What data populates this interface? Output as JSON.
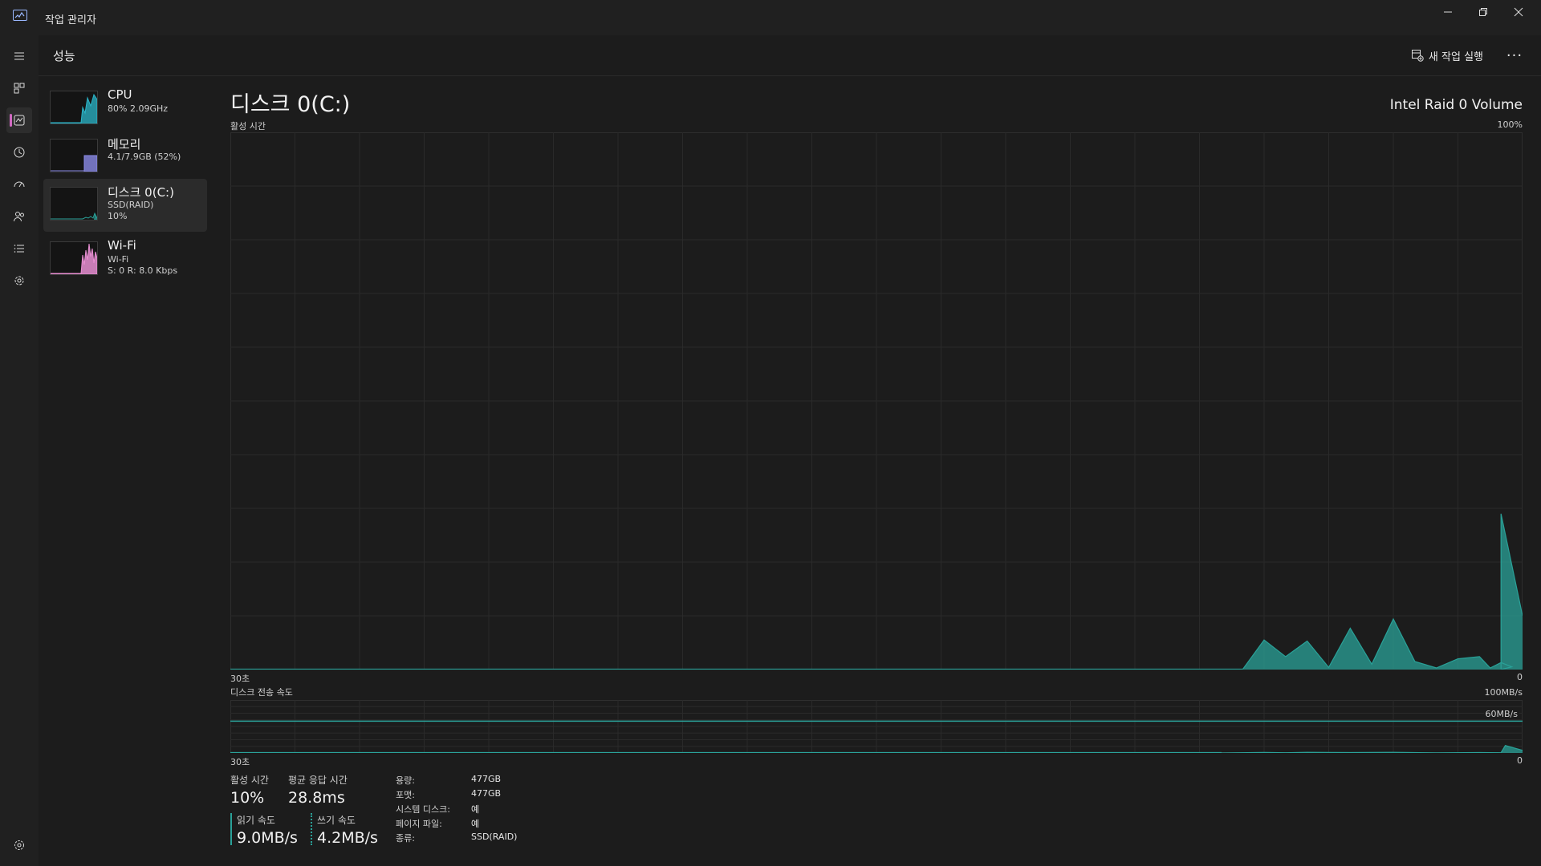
{
  "window": {
    "title": "작업 관리자",
    "controls": {
      "minimize": "—",
      "restore": "❐",
      "close": "✕"
    }
  },
  "rail": {
    "items": [
      {
        "icon": "hamburger-menu-icon"
      },
      {
        "icon": "processes-icon"
      },
      {
        "icon": "performance-icon",
        "active": true
      },
      {
        "icon": "app-history-icon"
      },
      {
        "icon": "startup-apps-icon"
      },
      {
        "icon": "users-icon"
      },
      {
        "icon": "details-icon"
      },
      {
        "icon": "services-icon"
      }
    ],
    "settings_icon": "gear-icon",
    "accent": "#d16ac2"
  },
  "header": {
    "title": "성능",
    "run_task_label": "새 작업 실행",
    "more_label": "···"
  },
  "devices": [
    {
      "name": "CPU",
      "line1": "80%  2.09GHz",
      "line2": "",
      "color": "#2bb5c9"
    },
    {
      "name": "메모리",
      "line1": "4.1/7.9GB (52%)",
      "line2": "",
      "color": "#8a8ae6"
    },
    {
      "name": "디스크 0(C:)",
      "line1": "SSD(RAID)",
      "line2": "10%",
      "color": "#2aa198",
      "selected": true
    },
    {
      "name": "Wi-Fi",
      "line1": "Wi-Fi",
      "line2": "S: 0  R: 8.0 Kbps",
      "color": "#e88ed2"
    }
  ],
  "main": {
    "title": "디스크 0(C:)",
    "model": "Intel Raid 0 Volume",
    "chart1": {
      "label": "활성 시간",
      "max_label": "100%",
      "time_left": "30초",
      "time_right": "0"
    },
    "chart2": {
      "label": "디스크 전송 속도",
      "max_label": "100MB/s",
      "ref_label": "60MB/s",
      "time_left": "30초",
      "time_right": "0"
    }
  },
  "stats": {
    "active_time_label": "활성 시간",
    "active_time_value": "10%",
    "avg_response_label": "평균 응답 시간",
    "avg_response_value": "28.8ms",
    "read_label": "읽기 속도",
    "read_value": "9.0MB/s",
    "write_label": "쓰기 속도",
    "write_value": "4.2MB/s",
    "props": [
      {
        "label": "용량:",
        "value": "477GB"
      },
      {
        "label": "포맷:",
        "value": "477GB"
      },
      {
        "label": "시스템 디스크:",
        "value": "예"
      },
      {
        "label": "페이지 파일:",
        "value": "예"
      },
      {
        "label": "종류:",
        "value": "SSD(RAID)"
      }
    ]
  },
  "chart_data": [
    {
      "type": "area",
      "title": "활성 시간",
      "xlabel": "",
      "ylabel": "",
      "x": [
        30,
        29,
        28,
        27,
        26,
        25,
        24,
        23,
        22,
        21,
        20,
        19,
        18,
        17,
        16,
        15,
        14,
        13,
        12,
        11,
        10,
        9,
        8,
        7,
        6,
        5,
        4,
        3,
        2,
        1,
        0
      ],
      "series": [
        {
          "values": [
            0,
            0,
            0,
            0,
            0,
            0,
            0,
            0,
            0,
            0,
            0,
            0,
            0,
            0,
            0,
            0,
            0,
            0,
            0,
            0,
            0,
            0,
            0,
            0,
            0,
            0,
            0,
            0,
            0,
            0,
            0
          ]
        }
      ],
      "detail_values": [
        0,
        0,
        0,
        0,
        0,
        0,
        0,
        0,
        0,
        0,
        0,
        0,
        0,
        0,
        0,
        0,
        0,
        0,
        0,
        0,
        0,
        0,
        0,
        0,
        0,
        0,
        0,
        0,
        0,
        0,
        0,
        0,
        0,
        0,
        0,
        0,
        0,
        0,
        0,
        0,
        0,
        0,
        0,
        0,
        0,
        0,
        0,
        0,
        0,
        0,
        0,
        0,
        0,
        0,
        0,
        0,
        0,
        0,
        0,
        0,
        0,
        0,
        0,
        0,
        0,
        0,
        0,
        0,
        0,
        0,
        0,
        0,
        0,
        0,
        0,
        0,
        0,
        0,
        0,
        0,
        0,
        0,
        0,
        0,
        0,
        0,
        0,
        0,
        0,
        0,
        0,
        0,
        0,
        0,
        0,
        0,
        0,
        0,
        0,
        0,
        0,
        0,
        0,
        0,
        0,
        0,
        0,
        0,
        0,
        0,
        0,
        0,
        0,
        0,
        0,
        0,
        0,
        0,
        0,
        0,
        0,
        0,
        0,
        0,
        0,
        0,
        0,
        0,
        0,
        0,
        0,
        0,
        0,
        0,
        0,
        0,
        0,
        0,
        0,
        0,
        0,
        0,
        0,
        0,
        0,
        0,
        0,
        0,
        0,
        0,
        0,
        0,
        0,
        0,
        0,
        0,
        0,
        0,
        0,
        0,
        0,
        0,
        0,
        0,
        0,
        0,
        0,
        0,
        0,
        0,
        0,
        0,
        0,
        0,
        0,
        0,
        0,
        0,
        0,
        0,
        0,
        0,
        0,
        0,
        0,
        0,
        0,
        0,
        0,
        0,
        0,
        0,
        0,
        0,
        0,
        0,
        0,
        0,
        0,
        0,
        0,
        0,
        0,
        0,
        0,
        0,
        0,
        0,
        0,
        0,
        0,
        0,
        0,
        0,
        0,
        0,
        0,
        0,
        0,
        0,
        0,
        0,
        0,
        0,
        0,
        0,
        0,
        0,
        0,
        0,
        0,
        0,
        0,
        0,
        0,
        0,
        0,
        0,
        0,
        0,
        0,
        0,
        0,
        0,
        0,
        0,
        0,
        0,
        0,
        0,
        0,
        0,
        0,
        0,
        0,
        0,
        0,
        0,
        0,
        0,
        0,
        0,
        0,
        0,
        0,
        0,
        0,
        0,
        0,
        0,
        0,
        0,
        0,
        0,
        0,
        0,
        0,
        0,
        0,
        0,
        0,
        0,
        0,
        0
      ],
      "points": [
        {
          "x": 6.5,
          "y": 0
        },
        {
          "x": 6.0,
          "y": 5.5
        },
        {
          "x": 5.5,
          "y": 2.4
        },
        {
          "x": 5.0,
          "y": 5.3
        },
        {
          "x": 4.5,
          "y": 0.4
        },
        {
          "x": 4.0,
          "y": 7.7
        },
        {
          "x": 3.5,
          "y": 1.0
        },
        {
          "x": 3.0,
          "y": 9.4
        },
        {
          "x": 2.5,
          "y": 1.5
        },
        {
          "x": 2.0,
          "y": 0.3
        },
        {
          "x": 1.5,
          "y": 2.0
        },
        {
          "x": 1.0,
          "y": 2.4
        },
        {
          "x": 0.75,
          "y": 0.3
        },
        {
          "x": 0.5,
          "y": 1.3
        },
        {
          "x": 0.25,
          "y": 0.5
        },
        {
          "x": 0.5,
          "y": 0
        },
        {
          "x": 0.5,
          "y": 29.0
        },
        {
          "x": 0,
          "y": 10.0
        }
      ],
      "ylim": [
        0,
        100
      ],
      "color": "#2aa198",
      "grid": true
    },
    {
      "type": "area",
      "title": "디스크 전송 속도",
      "ylim": [
        0,
        100
      ],
      "reference_line": 60,
      "points": [
        {
          "x": 7,
          "y": 0
        },
        {
          "x": 6,
          "y": 1
        },
        {
          "x": 5.5,
          "y": 0.5
        },
        {
          "x": 5,
          "y": 1.2
        },
        {
          "x": 4,
          "y": 0.8
        },
        {
          "x": 3,
          "y": 1.2
        },
        {
          "x": 2,
          "y": 0.3
        },
        {
          "x": 1,
          "y": 0.8
        },
        {
          "x": 0.5,
          "y": 0.4
        },
        {
          "x": 0.4,
          "y": 14
        },
        {
          "x": 0,
          "y": 5
        }
      ],
      "color": "#2aa198",
      "grid": true
    }
  ]
}
